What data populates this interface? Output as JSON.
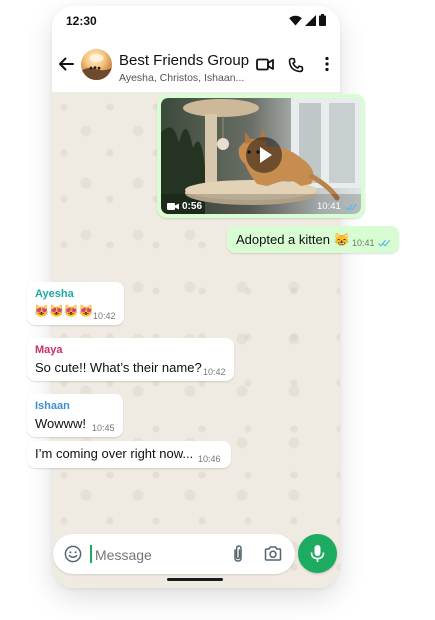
{
  "status_bar": {
    "time": "12:30"
  },
  "header": {
    "title": "Best Friends Group",
    "subtitle": "Ayesha, Christos, Ishaan..."
  },
  "messages": {
    "video": {
      "duration": "0:56",
      "time": "10:41"
    },
    "adopted": {
      "text": "Adopted a kitten 😸",
      "time": "10:41",
      "status": "read"
    },
    "ayesha": {
      "sender": "Ayesha",
      "sender_color": "#1fa8a3",
      "text": "😻😻😻😻",
      "time": "10:42"
    },
    "maya": {
      "sender": "Maya",
      "sender_color": "#c7306a",
      "text": "So cute!! What’s their name?",
      "time": "10:42"
    },
    "ishaan": {
      "sender": "Ishaan",
      "sender_color": "#3d8fd1",
      "text": "Wowww!",
      "time": "10:45"
    },
    "ishaan_2": {
      "text": "I’m coming over right now...",
      "time": "10:46"
    }
  },
  "composer": {
    "placeholder": "Message"
  },
  "colors": {
    "accent": "#1daa61",
    "outgoing_bubble": "#d9fdd3",
    "chat_background": "#efeae2",
    "read_ticks": "#53bdeb"
  },
  "icons": {
    "back": "arrow-left",
    "video_call": "video-camera",
    "voice_call": "phone",
    "menu": "kebab-vertical",
    "emoji": "smiley",
    "attach": "paperclip",
    "camera": "camera",
    "mic": "microphone",
    "play": "play"
  }
}
